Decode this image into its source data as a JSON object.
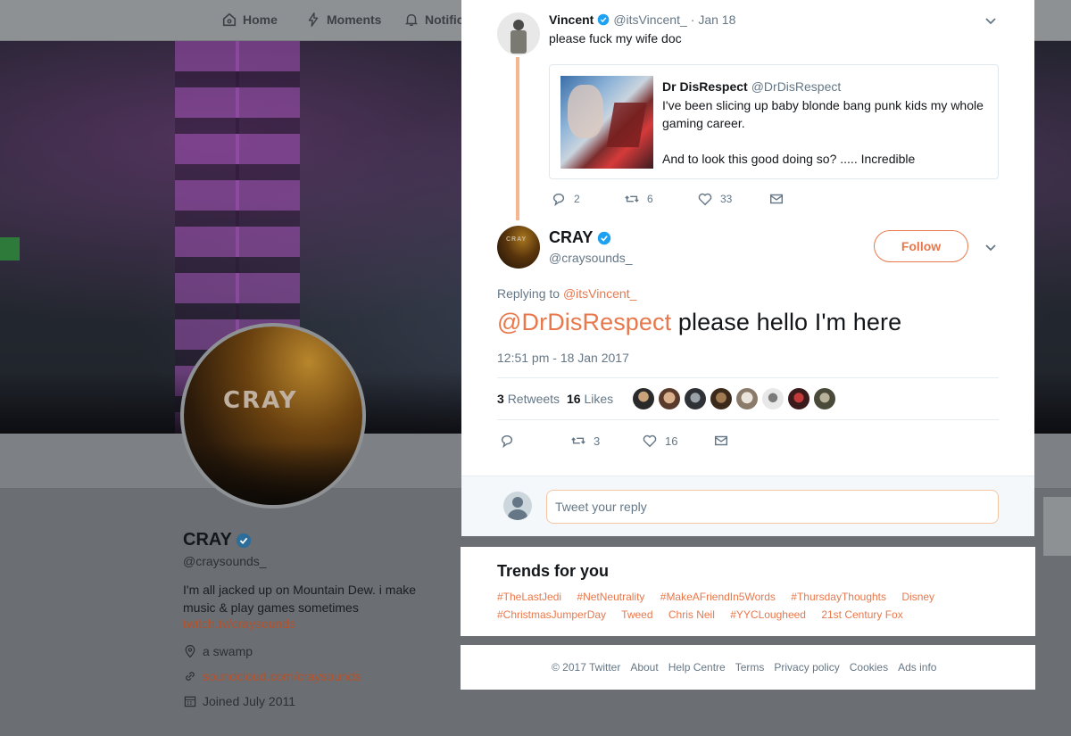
{
  "nav": {
    "home": "Home",
    "moments": "Moments",
    "notifications": "Notific"
  },
  "profile": {
    "name": "CRAY",
    "handle": "@craysounds_",
    "bio": "I'm all jacked up on Mountain Dew. i make music & play games sometimes",
    "bio_link": "twitch.tv/craysounds",
    "location": "a swamp",
    "website": "soundcloud.com/craysounds",
    "joined": "Joined July 2011",
    "avatar_text": "CRAY"
  },
  "parent_tweet": {
    "name": "Vincent",
    "handle": "@itsVincent_",
    "date": "· Jan 18",
    "text": "please fuck my wife doc",
    "quote": {
      "name": "Dr DisRespect",
      "handle": "@DrDisRespect",
      "text1": "I've been slicing up baby blonde bang punk kids my whole gaming career.",
      "text2": "And to look this good doing so?  ..... Incredible"
    },
    "replies": "2",
    "retweets": "6",
    "likes": "33"
  },
  "main_tweet": {
    "name": "CRAY",
    "handle": "@craysounds_",
    "follow_label": "Follow",
    "replying_label": "Replying to",
    "replying_to": "@itsVincent_",
    "mention": "@DrDisRespect",
    "text": " please hello I'm here",
    "timestamp": "12:51 pm - 18 Jan 2017",
    "retweet_count": "3",
    "retweet_label": "Retweets",
    "like_count": "16",
    "like_label": "Likes",
    "action_retweets": "3",
    "action_likes": "16",
    "avatar_text": "CRAY"
  },
  "reply_box": {
    "placeholder": "Tweet your reply"
  },
  "trends": {
    "title": "Trends for you",
    "items": [
      "#TheLastJedi",
      "#NetNeutrality",
      "#MakeAFriendIn5Words",
      "#ThursdayThoughts",
      "Disney",
      "#ChristmasJumperDay",
      "Tweed",
      "Chris Neil",
      "#YYCLougheed",
      "21st Century Fox"
    ]
  },
  "footer": {
    "links": [
      "© 2017 Twitter",
      "About",
      "Help Centre",
      "Terms",
      "Privacy policy",
      "Cookies",
      "Ads info"
    ]
  },
  "colors": {
    "accent": "#e8784b",
    "verified": "#1da1f2",
    "muted": "#657786",
    "thread_line": "#f7b690"
  }
}
